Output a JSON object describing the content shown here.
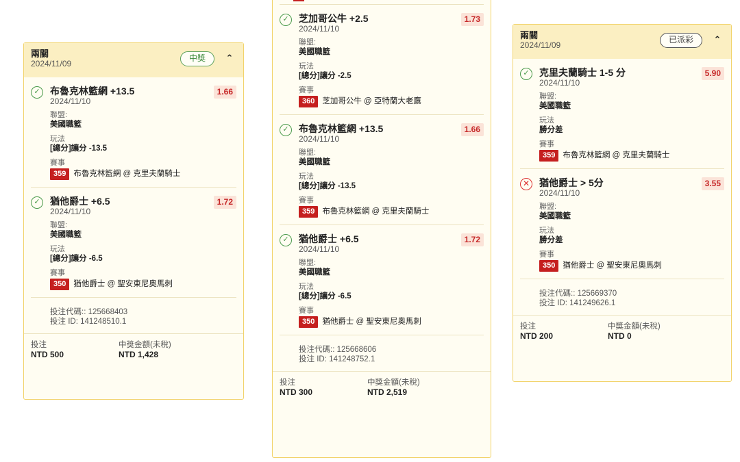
{
  "cards": [
    {
      "type": "兩關",
      "date": "2024/11/09",
      "status": "中獎",
      "legs": [
        {
          "title": "布魯克林籃網 +13.5",
          "date": "2024/11/10",
          "odds": "1.66",
          "league_label": "聯盟:",
          "league": "美國職籃",
          "market_label": "玩法",
          "market": "[總分]讓分 -13.5",
          "event_label": "賽事",
          "match_num": "359",
          "match": "布魯克林籃網 @ 克里夫蘭騎士",
          "result": "won"
        },
        {
          "title": "猶他爵士 +6.5",
          "date": "2024/11/10",
          "odds": "1.72",
          "league_label": "聯盟:",
          "league": "美國職籃",
          "market_label": "玩法",
          "market": "[總分]讓分 -6.5",
          "event_label": "賽事",
          "match_num": "350",
          "match": "猶他爵士 @ 聖安東尼奧馬刺",
          "result": "won"
        }
      ],
      "bet_code": "投注代碼:: 125668403",
      "bet_id": "投注 ID: 141248510.1",
      "stake_label": "投注",
      "stake": "NTD 500",
      "payout_label": "中獎金額(未稅)",
      "payout": "NTD 1,428"
    },
    {
      "type": "",
      "date": "",
      "status": "",
      "legs": [
        {
          "title": "芝加哥公牛 +2.5",
          "date": "2024/11/10",
          "odds": "1.73",
          "league_label": "聯盟:",
          "league": "美國職籃",
          "market_label": "玩法",
          "market": "[總分]讓分 -2.5",
          "event_label": "賽事",
          "match_num": "360",
          "match": "芝加哥公牛 @ 亞特蘭大老鷹",
          "result": "won"
        },
        {
          "title": "布魯克林籃網 +13.5",
          "date": "2024/11/10",
          "odds": "1.66",
          "league_label": "聯盟:",
          "league": "美國職籃",
          "market_label": "玩法",
          "market": "[總分]讓分 -13.5",
          "event_label": "賽事",
          "match_num": "359",
          "match": "布魯克林籃網 @ 克里夫蘭騎士",
          "result": "won"
        },
        {
          "title": "猶他爵士 +6.5",
          "date": "2024/11/10",
          "odds": "1.72",
          "league_label": "聯盟:",
          "league": "美國職籃",
          "market_label": "玩法",
          "market": "[總分]讓分 -6.5",
          "event_label": "賽事",
          "match_num": "350",
          "match": "猶他爵士 @ 聖安東尼奧馬刺",
          "result": "won"
        }
      ],
      "bet_code": "投注代碼:: 125668606",
      "bet_id": "投注 ID: 141248752.1",
      "stake_label": "投注",
      "stake": "NTD 300",
      "payout_label": "中獎金額(未稅)",
      "payout": "NTD 2,519"
    },
    {
      "type": "兩關",
      "date": "2024/11/09",
      "status": "已派彩",
      "legs": [
        {
          "title": "克里夫蘭騎士 1-5 分",
          "date": "2024/11/10",
          "odds": "5.90",
          "league_label": "聯盟:",
          "league": "美國職籃",
          "market_label": "玩法",
          "market": "勝分差",
          "event_label": "賽事",
          "match_num": "359",
          "match": "布魯克林籃網 @ 克里夫蘭騎士",
          "result": "won"
        },
        {
          "title": "猶他爵士 > 5分",
          "date": "2024/11/10",
          "odds": "3.55",
          "league_label": "聯盟:",
          "league": "美國職籃",
          "market_label": "玩法",
          "market": "勝分差",
          "event_label": "賽事",
          "match_num": "350",
          "match": "猶他爵士 @ 聖安東尼奧馬刺",
          "result": "lost"
        }
      ],
      "bet_code": "投注代碼:: 125669370",
      "bet_id": "投注 ID: 141249626.1",
      "stake_label": "投注",
      "stake": "NTD 200",
      "payout_label": "中獎金額(未稅)",
      "payout": "NTD 0"
    }
  ],
  "icons": {
    "won": "check-circle-icon",
    "lost": "x-circle-icon",
    "collapse": "chevron-up-icon"
  },
  "colors": {
    "accent_border": "#f2d36b",
    "header_bg": "#fbefc2",
    "win": "#4b9a4b",
    "lose": "#d33333",
    "odds": "#c62828",
    "match_badge": "#c51f1f"
  }
}
